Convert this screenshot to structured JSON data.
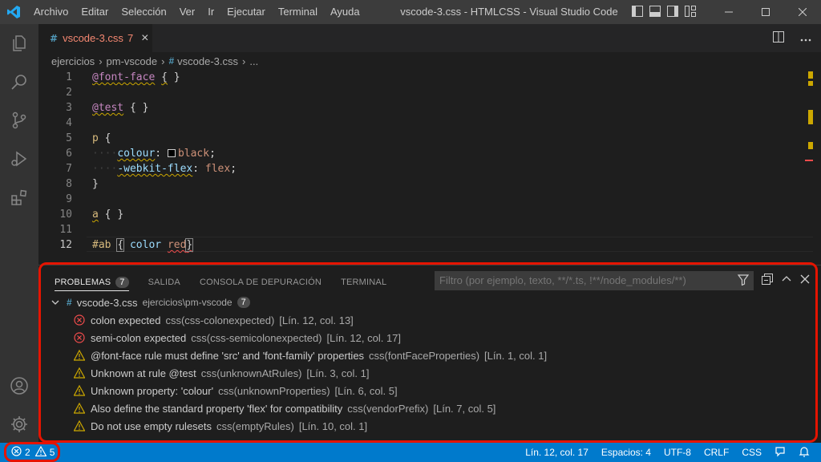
{
  "titlebar": {
    "menu": [
      "Archivo",
      "Editar",
      "Selección",
      "Ver",
      "Ir",
      "Ejecutar",
      "Terminal",
      "Ayuda"
    ],
    "window_title": "vscode-3.css - HTMLCSS - Visual Studio Code"
  },
  "activitybar": {
    "items": [
      "files-icon",
      "search-icon",
      "source-control-icon",
      "run-debug-icon",
      "extensions-icon"
    ],
    "bottom": [
      "account-icon",
      "settings-gear-icon"
    ]
  },
  "tab": {
    "icon": "#",
    "name": "vscode-3.css",
    "problem_count": "7",
    "close": "×"
  },
  "breadcrumb": {
    "parts": [
      "ejercicios",
      "pm-vscode"
    ],
    "file_icon": "#",
    "file": "vscode-3.css",
    "ellipsis": "..."
  },
  "editor": {
    "line_numbers": [
      "1",
      "2",
      "3",
      "4",
      "5",
      "6",
      "7",
      "8",
      "9",
      "10",
      "11",
      "12"
    ],
    "active_line": 12
  },
  "panel": {
    "tabs": [
      {
        "label": "PROBLEMAS",
        "badge": "7"
      },
      {
        "label": "SALIDA"
      },
      {
        "label": "CONSOLA DE DEPURACIÓN"
      },
      {
        "label": "TERMINAL"
      }
    ],
    "filter_placeholder": "Filtro (por ejemplo, texto, **/*.ts, !**/node_modules/**)",
    "group": {
      "icon": "#",
      "file": "vscode-3.css",
      "path": "ejercicios\\pm-vscode",
      "count": "7"
    },
    "problems": [
      {
        "severity": "error",
        "message": "colon expected",
        "source": "css(css-colonexpected)",
        "location": "[Lín. 12, col. 13]"
      },
      {
        "severity": "error",
        "message": "semi-colon expected",
        "source": "css(css-semicolonexpected)",
        "location": "[Lín. 12, col. 17]"
      },
      {
        "severity": "warning",
        "message": "@font-face rule must define 'src' and 'font-family' properties",
        "source": "css(fontFaceProperties)",
        "location": "[Lín. 1, col. 1]"
      },
      {
        "severity": "warning",
        "message": "Unknown at rule @test",
        "source": "css(unknownAtRules)",
        "location": "[Lín. 3, col. 1]"
      },
      {
        "severity": "warning",
        "message": "Unknown property: 'colour'",
        "source": "css(unknownProperties)",
        "location": "[Lín. 6, col. 5]"
      },
      {
        "severity": "warning",
        "message": "Also define the standard property 'flex' for compatibility",
        "source": "css(vendorPrefix)",
        "location": "[Lín. 7, col. 5]"
      },
      {
        "severity": "warning",
        "message": "Do not use empty rulesets",
        "source": "css(emptyRules)",
        "location": "[Lín. 10, col. 1]"
      }
    ]
  },
  "statusbar": {
    "errors": "2",
    "warnings": "5",
    "position": "Lín. 12, col. 17",
    "spaces": "Espacios: 4",
    "encoding": "UTF-8",
    "eol": "CRLF",
    "language": "CSS"
  },
  "colors": {
    "accent": "#007acc",
    "error": "#f14c4c",
    "warning": "#cca700",
    "highlight": "#e51400"
  }
}
